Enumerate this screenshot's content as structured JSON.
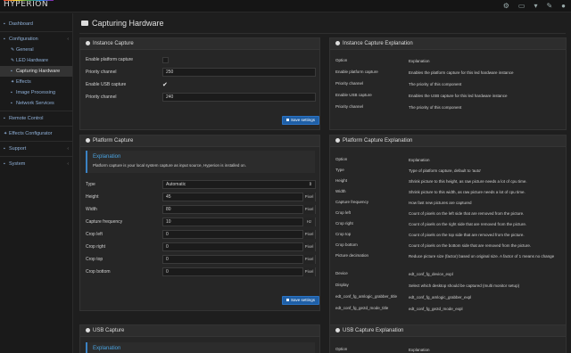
{
  "app": {
    "logo": "HYPERION",
    "top_icons": [
      "gear-icon",
      "monitor-icon",
      "instance-icon",
      "wrench-icon",
      "user-icon"
    ]
  },
  "sidebar": {
    "items": [
      {
        "label": "Dashboard",
        "icon": "dashboard-icon",
        "sub": false,
        "active": false
      },
      {
        "label": "Configuration",
        "icon": "config-icon",
        "sub": false,
        "active": false,
        "chevron": "‹"
      },
      {
        "label": "General",
        "icon": "pencil-icon",
        "sub": true,
        "active": false
      },
      {
        "label": "LED Hardware",
        "icon": "led-icon",
        "sub": true,
        "active": false
      },
      {
        "label": "Capturing Hardware",
        "icon": "camera-icon",
        "sub": true,
        "active": true
      },
      {
        "label": "Effects",
        "icon": "effects-icon",
        "sub": true,
        "active": false
      },
      {
        "label": "Image Processing",
        "icon": "image-icon",
        "sub": true,
        "active": false
      },
      {
        "label": "Network Services",
        "icon": "network-icon",
        "sub": true,
        "active": false
      },
      {
        "label": "Remote Control",
        "icon": "remote-icon",
        "sub": false,
        "active": false
      },
      {
        "label": "Effects Configurator",
        "icon": "effects-icon",
        "sub": false,
        "active": false
      },
      {
        "label": "Support",
        "icon": "support-icon",
        "sub": false,
        "active": false,
        "chevron": "‹"
      },
      {
        "label": "System",
        "icon": "system-icon",
        "sub": false,
        "active": false,
        "chevron": "‹"
      }
    ]
  },
  "page": {
    "title": "Capturing Hardware"
  },
  "instance_capture": {
    "title": "Instance Capture",
    "enable_platform_label": "Enable platform capture",
    "priority_label_1": "Priority channel",
    "priority_value_1": "250",
    "enable_usb_label": "Enable USB capture",
    "priority_label_2": "Priority channel",
    "priority_value_2": "240",
    "save_label": "Save settings"
  },
  "instance_expl": {
    "title": "Instance Capture Explanation",
    "col_option": "Option",
    "col_expl": "Explanation",
    "rows": [
      {
        "k": "Enable platform capture",
        "v": "Enables the platform capture for this led hardware instance"
      },
      {
        "k": "Priority channel",
        "v": "The priority of this component"
      },
      {
        "k": "Enable USB capture",
        "v": "Enables the USB capture for this led hardware instance"
      },
      {
        "k": "Priority channel",
        "v": "The priority of this component"
      }
    ]
  },
  "platform_capture": {
    "title": "Platform Capture",
    "info_title": "Explanation",
    "info_text": "Platform capture is your local system capture as input source, Hyperion is installed on.",
    "fields": [
      {
        "label": "Type",
        "value": "Automatic",
        "unit": ""
      },
      {
        "label": "Height",
        "value": "45",
        "unit": "Pixel"
      },
      {
        "label": "Width",
        "value": "80",
        "unit": "Pixel"
      },
      {
        "label": "Capture frequency",
        "value": "10",
        "unit": "Hz"
      },
      {
        "label": "Crop left",
        "value": "0",
        "unit": "Pixel"
      },
      {
        "label": "Crop right",
        "value": "0",
        "unit": "Pixel"
      },
      {
        "label": "Crop top",
        "value": "0",
        "unit": "Pixel"
      },
      {
        "label": "Crop bottom",
        "value": "0",
        "unit": "Pixel"
      }
    ],
    "save_label": "Save settings"
  },
  "platform_expl": {
    "title": "Platform Capture Explanation",
    "col_option": "Option",
    "col_expl": "Explanation",
    "rows": [
      {
        "k": "Type",
        "v": "Type of platform capture, default to 'auto'"
      },
      {
        "k": "Height",
        "v": "Shrink picture to this height, as raw picture needs a lot of cpu time."
      },
      {
        "k": "Width",
        "v": "Shrink picture to this width, as raw picture needs a lot of cpu time."
      },
      {
        "k": "Capture frequency",
        "v": "How fast new pictures are captured"
      },
      {
        "k": "Crop left",
        "v": "Count of pixels on the left side that are removed from the picture."
      },
      {
        "k": "Crop right",
        "v": "Count of pixels on the right side that are removed from the picture."
      },
      {
        "k": "Crop top",
        "v": "Count of pixels on the top side that are removed from the picture."
      },
      {
        "k": "Crop bottom",
        "v": "Count of pixels on the bottom side that are removed from the picture."
      },
      {
        "k": "Picture decimation",
        "v": "Reduce picture size (factor) based on original size. A factor of 1 means no change"
      },
      {
        "k": "Device",
        "v": "edt_conf_fg_device_expl"
      },
      {
        "k": "Display",
        "v": "Select which desktop should be captured (multi monitor setup)"
      },
      {
        "k": "edt_conf_fg_amlogic_grabber_title",
        "v": "edt_conf_fg_amlogic_grabber_expl"
      },
      {
        "k": "edt_conf_fg_ge2d_mode_title",
        "v": "edt_conf_fg_ge2d_mode_expl"
      }
    ]
  },
  "usb_capture": {
    "title": "USB Capture",
    "info_title": "Explanation"
  },
  "usb_expl": {
    "title": "USB Capture Explanation",
    "col_option": "Option",
    "col_expl": "Explanation"
  },
  "colors": {
    "accent": "#1f5fa6",
    "info": "#4aa3e0",
    "bg": "#1e1e1e",
    "panel": "#262626"
  }
}
